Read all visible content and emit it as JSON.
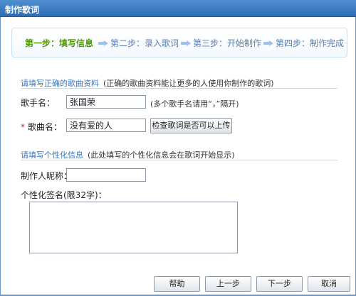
{
  "window": {
    "title": "制作歌词"
  },
  "steps": [
    {
      "label": "第一步：填写信息",
      "active": true
    },
    {
      "label": "第二步：录入歌词",
      "active": false
    },
    {
      "label": "第三步：开始制作",
      "active": false
    },
    {
      "label": "第四步：制作完成",
      "active": false
    }
  ],
  "song_section": {
    "title": "请填写正确的歌曲资料",
    "note": "(正确的歌曲资料能让更多的人使用你制作的歌词)",
    "singer_label": "歌手名：",
    "singer_value": "张国荣",
    "singer_hint": "(多个歌手名请用“，”隔开)",
    "required_mark": "*",
    "song_label": "歌曲名：",
    "song_value": "没有爱的人",
    "check_button": "检查歌词是否可以上传"
  },
  "personal_section": {
    "title": "请填写个性化信息",
    "note": "(此处填写的个性化信息会在歌词开始显示)",
    "nickname_label": "制作人昵称：",
    "nickname_value": "",
    "signature_label": "个性化签名(限32字)：",
    "signature_value": ""
  },
  "footer": {
    "help": "帮助",
    "prev": "上一步",
    "next": "下一步",
    "cancel": "取消"
  }
}
